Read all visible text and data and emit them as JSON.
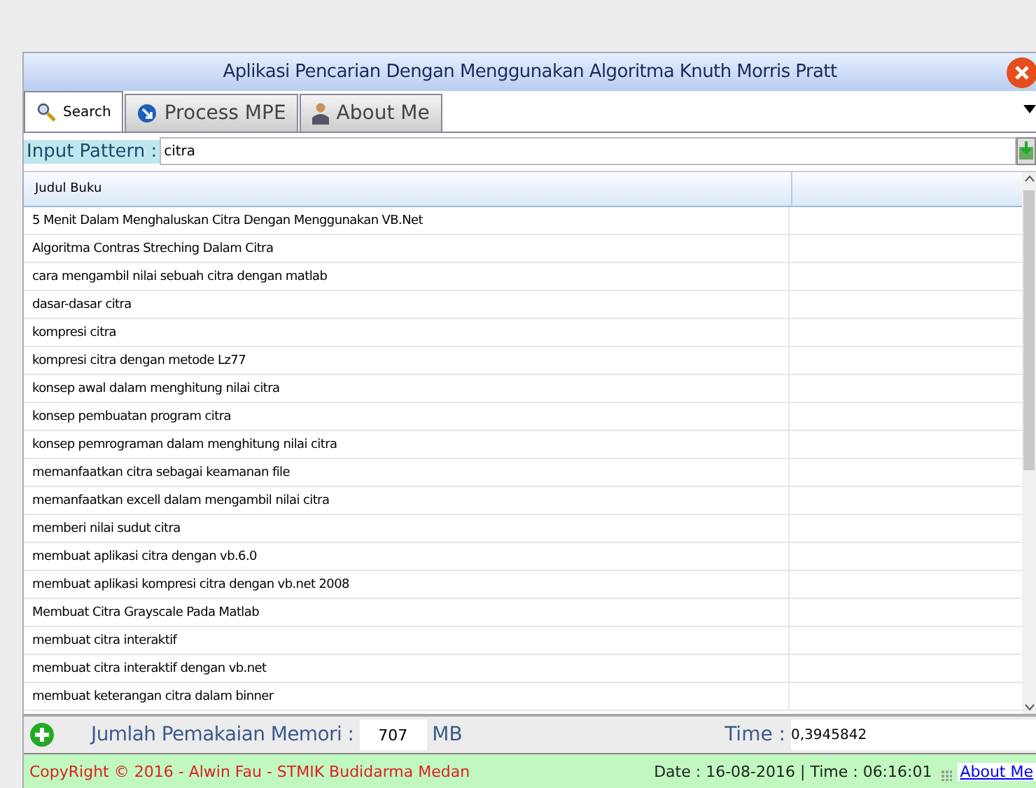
{
  "window": {
    "title": "Aplikasi Pencarian Dengan Menggunakan Algoritma Knuth Morris Pratt"
  },
  "tabs": [
    {
      "label": "Search",
      "selected": true
    },
    {
      "label": "Process MPE",
      "selected": false
    },
    {
      "label": "About Me",
      "selected": false
    }
  ],
  "input": {
    "label": "Input Pattern :",
    "value": "citra"
  },
  "table": {
    "columns": [
      "Judul Buku"
    ],
    "rows": [
      "5 Menit Dalam Menghaluskan Citra Dengan Menggunakan VB.Net",
      "Algoritma Contras Streching Dalam Citra",
      "cara mengambil nilai sebuah citra dengan matlab",
      "dasar-dasar citra",
      "kompresi citra",
      "kompresi citra dengan metode Lz77",
      "konsep awal dalam menghitung nilai citra",
      "konsep pembuatan program citra",
      "konsep pemrograman dalam menghitung nilai citra",
      "memanfaatkan citra sebagai keamanan file",
      "memanfaatkan excell dalam mengambil nilai citra",
      "memberi nilai sudut citra",
      "membuat aplikasi citra dengan vb.6.0",
      "membuat aplikasi kompresi citra dengan vb.net 2008",
      "Membuat Citra Grayscale Pada Matlab",
      "membuat citra interaktif",
      "membuat citra interaktif dengan vb.net",
      "membuat keterangan citra dalam binner"
    ]
  },
  "memory": {
    "label": "Jumlah Pemakaian Memori :",
    "value": "707",
    "unit": "MB",
    "time_label": "Time :",
    "time_value": "0,3945842"
  },
  "status_bar": {
    "copyright": "CopyRight © 2016 - Alwin Fau - STMIK Budidarma Medan",
    "datetime": "Date : 16-08-2016 | Time : 06:16:01",
    "link": "About Me"
  }
}
